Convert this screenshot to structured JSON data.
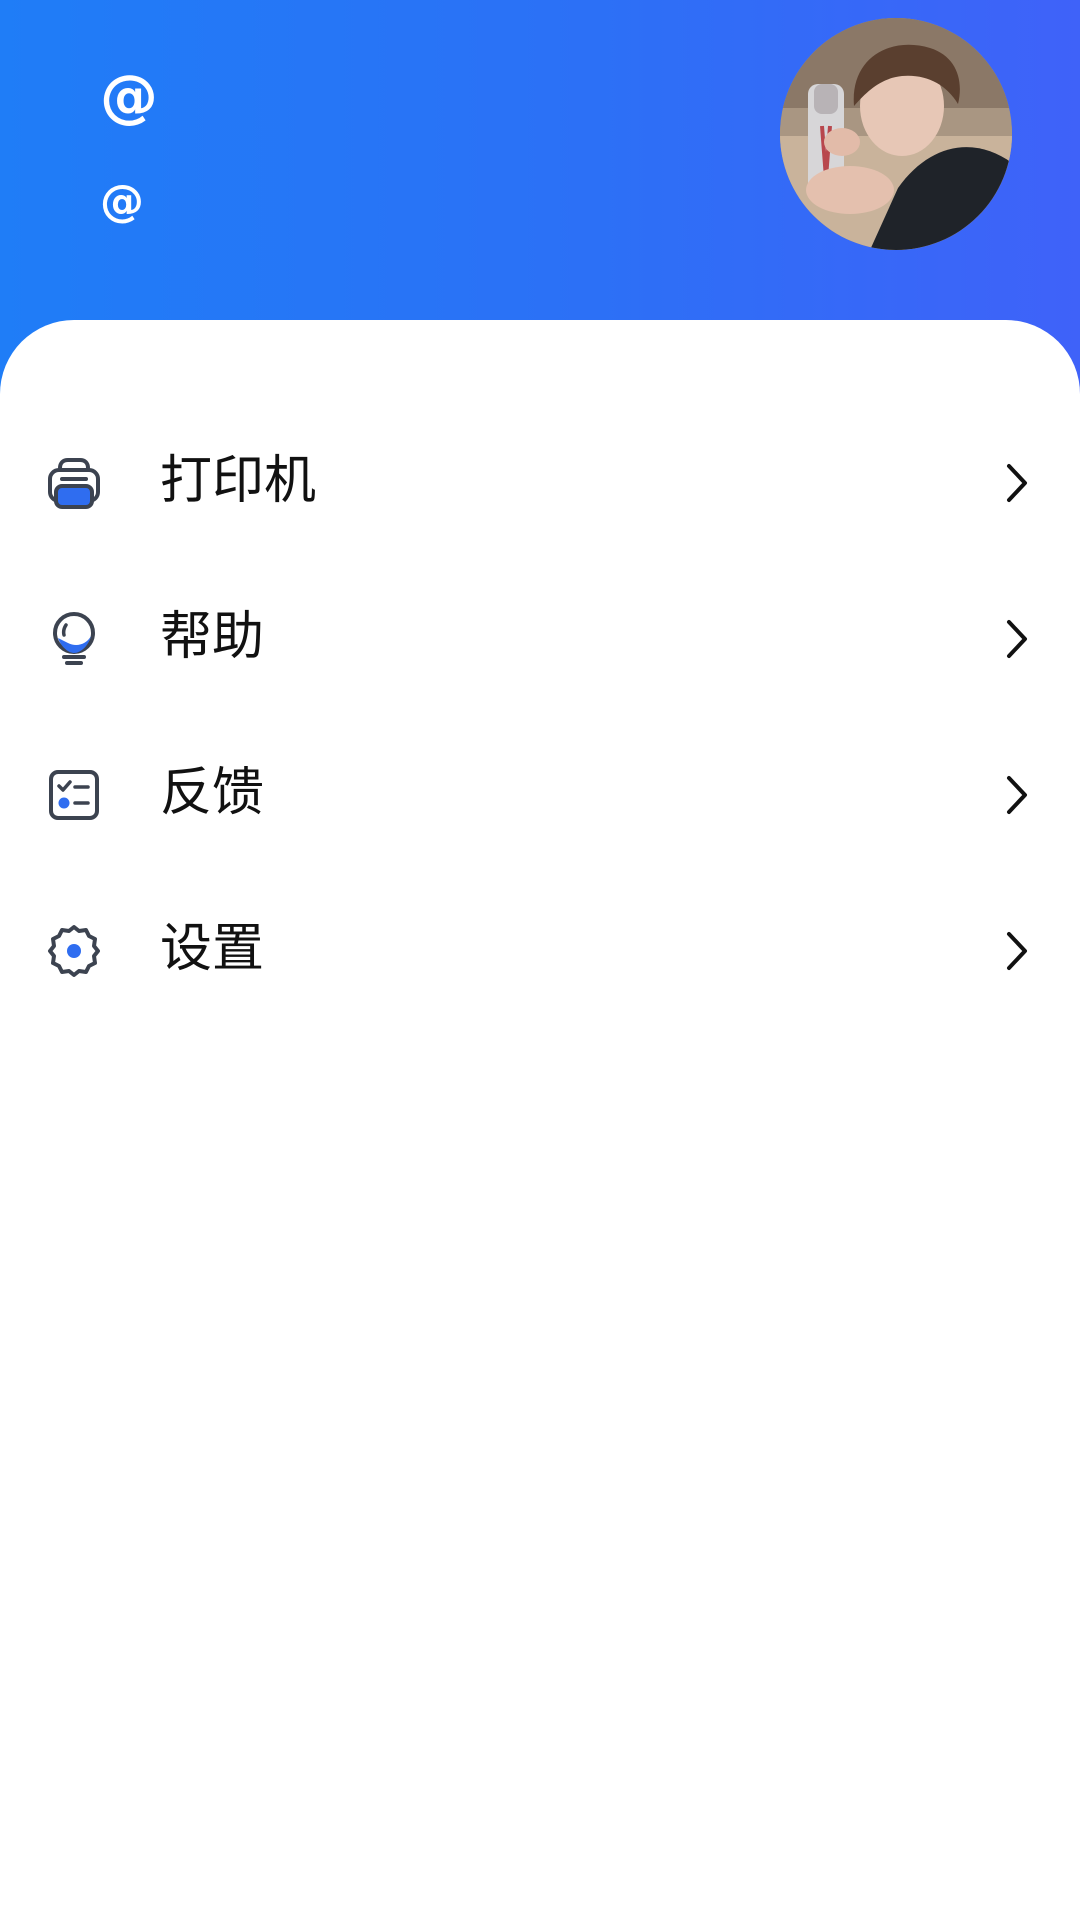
{
  "profile": {
    "name": "@",
    "account": "@",
    "avatar_icon": "avatar-photo"
  },
  "menu": {
    "items": [
      {
        "label": "打印机",
        "icon": "printer-icon"
      },
      {
        "label": "帮助",
        "icon": "lightbulb-icon"
      },
      {
        "label": "反馈",
        "icon": "feedback-checklist-icon"
      },
      {
        "label": "设置",
        "icon": "gear-icon"
      }
    ],
    "chevron_icon": "chevron-right-icon"
  },
  "colors": {
    "header_start": "#1f7df7",
    "header_end": "#3f62f9",
    "icon_stroke": "#3c4350",
    "icon_accent": "#2f6df0",
    "label_text": "#111111"
  }
}
